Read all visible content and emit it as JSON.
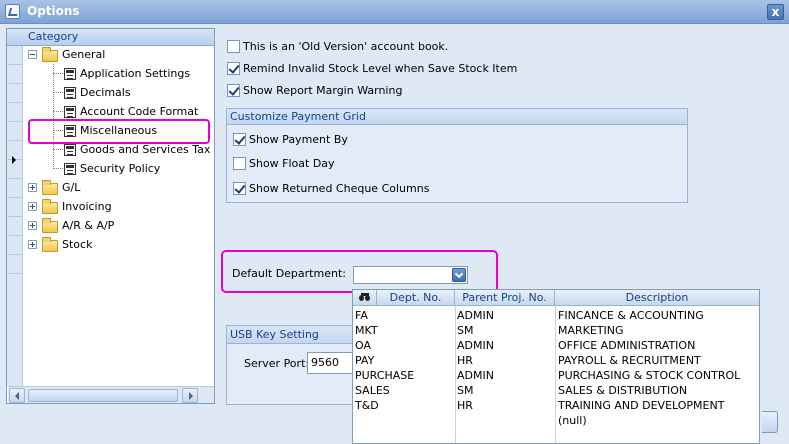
{
  "window": {
    "title": "Options",
    "close_label": "x"
  },
  "tree": {
    "header": "Category",
    "items": [
      {
        "label": "General"
      },
      {
        "label": "Application Settings"
      },
      {
        "label": "Decimals"
      },
      {
        "label": "Account Code Format"
      },
      {
        "label": "Miscellaneous"
      },
      {
        "label": "Goods and Services Tax"
      },
      {
        "label": "Security Policy"
      },
      {
        "label": "G/L"
      },
      {
        "label": "Invoicing"
      },
      {
        "label": "A/R & A/P"
      },
      {
        "label": "Stock"
      }
    ]
  },
  "options": {
    "old_version": {
      "label": "This is an 'Old Version' account book.",
      "checked": false
    },
    "remind_stock": {
      "label": "Remind Invalid Stock Level when Save Stock Item",
      "checked": true
    },
    "report_margin": {
      "label": "Show Report Margin Warning",
      "checked": true
    }
  },
  "payment_grid": {
    "title": "Customize Payment Grid",
    "show_payment_by": {
      "label": "Show Payment By",
      "checked": true
    },
    "show_float_day": {
      "label": "Show Float Day",
      "checked": false
    },
    "show_returned_cheque": {
      "label": "Show Returned Cheque Columns",
      "checked": true
    }
  },
  "default_department": {
    "label": "Default Department:",
    "value": ""
  },
  "usb": {
    "title": "USB Key Setting",
    "port_label": "Server Port:",
    "port_value": "9560"
  },
  "dropdown": {
    "columns": [
      "Dept. No.",
      "Parent Proj. No.",
      "Description"
    ],
    "rows": [
      {
        "dept": "FA",
        "parent": "ADMIN",
        "desc": "FINCANCE & ACCOUNTING"
      },
      {
        "dept": "MKT",
        "parent": "SM",
        "desc": "MARKETING"
      },
      {
        "dept": "OA",
        "parent": "ADMIN",
        "desc": "OFFICE ADMINISTRATION"
      },
      {
        "dept": "PAY",
        "parent": "HR",
        "desc": "PAYROLL & RECRUITMENT"
      },
      {
        "dept": "PURCHASE",
        "parent": "ADMIN",
        "desc": "PURCHASING & STOCK CONTROL"
      },
      {
        "dept": "SALES",
        "parent": "SM",
        "desc": "SALES & DISTRIBUTION"
      },
      {
        "dept": "T&D",
        "parent": "HR",
        "desc": "TRAINING AND DEVELOPMENT"
      },
      {
        "dept": "",
        "parent": "",
        "desc": "(null)"
      }
    ]
  },
  "colors": {
    "highlight": "#e600d6",
    "titlebar": "#7ea3d4",
    "header_text": "#15428b"
  }
}
